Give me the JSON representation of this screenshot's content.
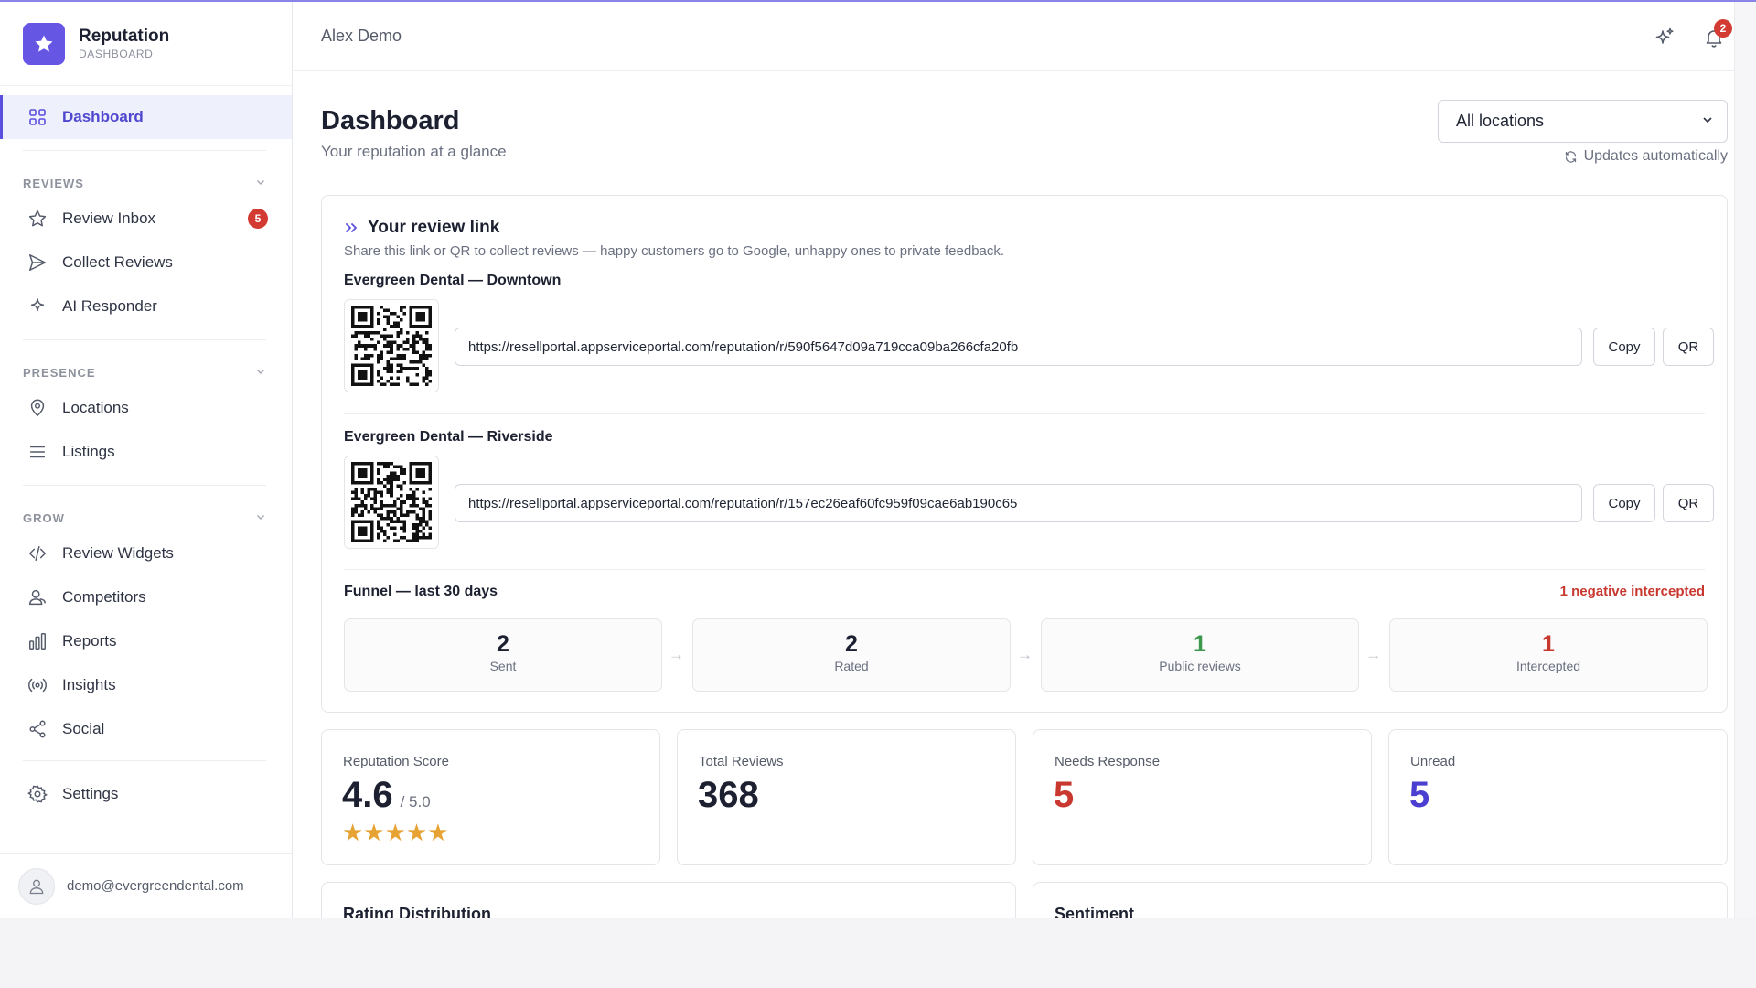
{
  "brand": {
    "title": "Reputation",
    "subtitle": "DASHBOARD"
  },
  "nav": {
    "dashboard": "Dashboard",
    "reviews_header": "REVIEWS",
    "review_inbox": "Review Inbox",
    "review_inbox_badge": "5",
    "collect_reviews": "Collect Reviews",
    "ai_responder": "AI Responder",
    "presence_header": "PRESENCE",
    "locations": "Locations",
    "listings": "Listings",
    "grow_header": "GROW",
    "review_widgets": "Review Widgets",
    "competitors": "Competitors",
    "reports": "Reports",
    "insights": "Insights",
    "social": "Social",
    "settings": "Settings"
  },
  "user": {
    "email": "demo@evergreendental.com"
  },
  "topbar": {
    "user_name": "Alex Demo",
    "notification_count": "2"
  },
  "page": {
    "title": "Dashboard",
    "subtitle": "Your reputation at a glance",
    "location_select": "All locations",
    "auto_update": "Updates automatically"
  },
  "review_link": {
    "title": "Your review link",
    "description": "Share this link or QR to collect reviews — happy customers go to Google, unhappy ones to private feedback.",
    "copy_label": "Copy",
    "qr_label": "QR",
    "locations": [
      {
        "name": "Evergreen Dental — Downtown",
        "url": "https://resellportal.appserviceportal.com/reputation/r/590f5647d09a719cca09ba266cfa20fb"
      },
      {
        "name": "Evergreen Dental — Riverside",
        "url": "https://resellportal.appserviceportal.com/reputation/r/157ec26eaf60fc959f09cae6ab190c65"
      }
    ]
  },
  "funnel": {
    "title": "Funnel — last 30 days",
    "negative_note": "1 negative intercepted",
    "steps": [
      {
        "value": "2",
        "label": "Sent"
      },
      {
        "value": "2",
        "label": "Rated"
      },
      {
        "value": "1",
        "label": "Public reviews"
      },
      {
        "value": "1",
        "label": "Intercepted"
      }
    ]
  },
  "stats": {
    "reputation_label": "Reputation Score",
    "reputation_value": "4.6",
    "reputation_of": "/ 5.0",
    "reputation_stars": "★★★★★",
    "total_label": "Total Reviews",
    "total_value": "368",
    "needs_label": "Needs Response",
    "needs_value": "5",
    "unread_label": "Unread",
    "unread_value": "5"
  },
  "sections": {
    "rating_distribution": "Rating Distribution",
    "sentiment": "Sentiment"
  },
  "colors": {
    "accent": "#5b4fe0",
    "danger": "#c8382f",
    "success": "#3d9a4c",
    "star": "#e6a232",
    "unread": "#4a3fd1"
  }
}
